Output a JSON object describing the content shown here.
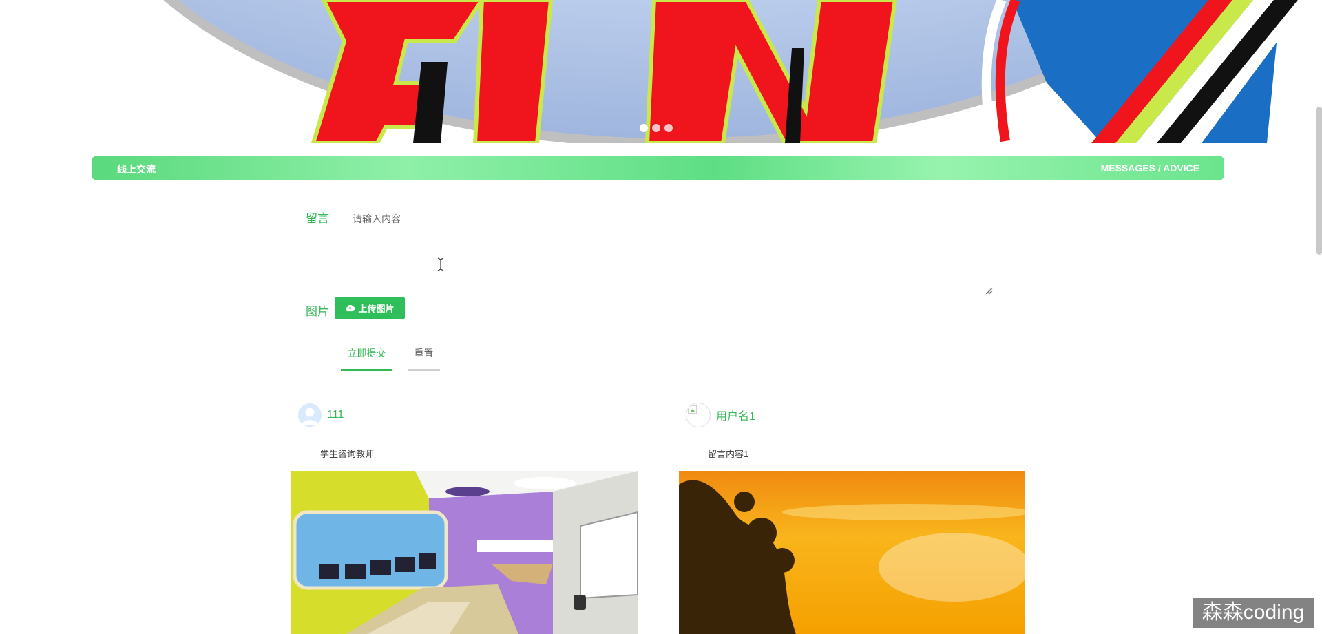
{
  "banner": {
    "slides": 3,
    "active_slide": 1
  },
  "section": {
    "title": "线上交流",
    "subtitle": "MESSAGES / ADVICE"
  },
  "form": {
    "message_label": "留言",
    "message_placeholder": "请输入内容",
    "picture_label": "图片",
    "upload_label": "上传图片",
    "submit_label": "立即提交",
    "reset_label": "重置"
  },
  "messages": [
    {
      "username": "111",
      "content": "学生咨询教师"
    },
    {
      "username": "用户名1",
      "content": "留言内容1"
    }
  ],
  "watermark": "森森coding",
  "colors": {
    "accent_green": "#35b856",
    "button_green": "#2fbf5a",
    "banner_red": "#f0141c",
    "banner_blue": "#1a6fc4"
  }
}
